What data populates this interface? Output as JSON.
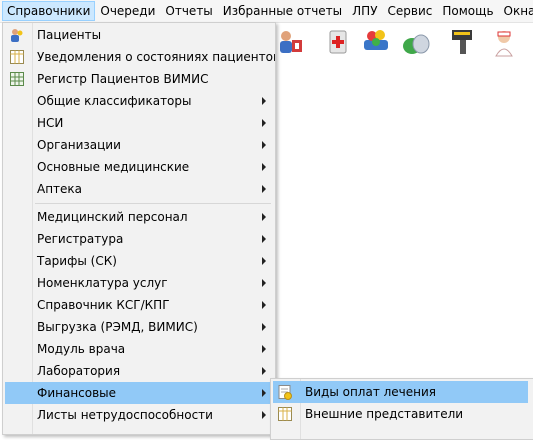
{
  "menubar": {
    "items": [
      "Справочники",
      "Очереди",
      "Отчеты",
      "Избранные отчеты",
      "ЛПУ",
      "Сервис",
      "Помощь",
      "Окна"
    ]
  },
  "toolbar": {
    "icons": [
      "patients-icon",
      "medicine-box-icon",
      "pills-icon",
      "capsule-icon",
      "barcode-scanner-icon",
      "nurse-icon"
    ]
  },
  "menu": {
    "items": [
      {
        "label": "Пациенты",
        "icon": "patients-icon",
        "submenu": false
      },
      {
        "label": "Уведомления о состояниях пациентов",
        "icon": "table-icon",
        "submenu": false
      },
      {
        "label": "Регистр Пациентов ВИМИС",
        "icon": "grid-icon",
        "submenu": false
      },
      {
        "label": "Общие классификаторы",
        "submenu": true
      },
      {
        "label": "НСИ",
        "submenu": true
      },
      {
        "label": "Организации",
        "submenu": true
      },
      {
        "label": "Основные медицинские",
        "submenu": true
      },
      {
        "label": "Аптека",
        "submenu": true
      },
      {
        "label": "Медицинский персонал",
        "submenu": true
      },
      {
        "label": "Регистратура",
        "submenu": true
      },
      {
        "label": "Тарифы (СК)",
        "submenu": true
      },
      {
        "label": "Номенклатура услуг",
        "submenu": true
      },
      {
        "label": "Справочник КСГ/КПГ",
        "submenu": true
      },
      {
        "label": "Выгрузка (РЭМД, ВИМИС)",
        "submenu": true
      },
      {
        "label": "Модуль врача",
        "submenu": true
      },
      {
        "label": "Лаборатория",
        "submenu": true
      },
      {
        "label": "Финансовые",
        "submenu": true,
        "highlighted": true
      },
      {
        "label": "Листы нетрудоспособности",
        "submenu": true
      }
    ]
  },
  "submenu": {
    "items": [
      {
        "label": "Виды оплат лечения",
        "icon": "payment-icon",
        "highlighted": true
      },
      {
        "label": "Внешние представители",
        "icon": "table-icon"
      }
    ]
  },
  "colors": {
    "highlight": "#91c9f7",
    "menubar_active": "#cce8ff",
    "menu_bg": "#f2f2f2"
  }
}
